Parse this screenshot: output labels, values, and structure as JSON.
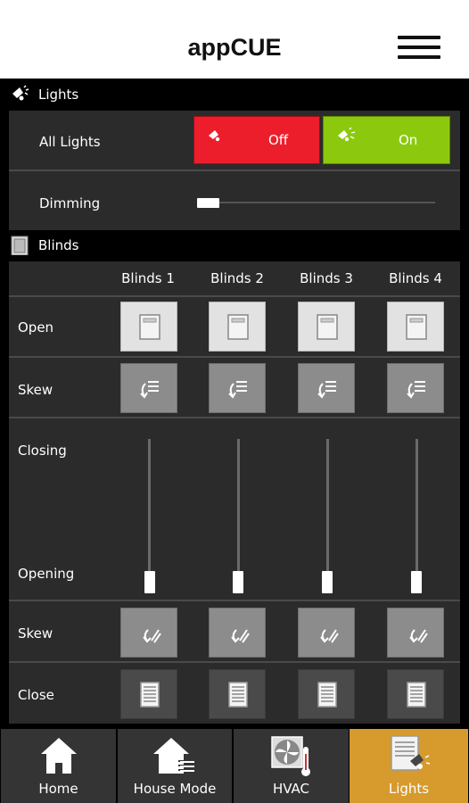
{
  "header": {
    "title": "appCUE",
    "menu_icon": "hamburger-icon"
  },
  "lights": {
    "section_title": "Lights",
    "section_icon": "lamp-icon",
    "all_lights_label": "All Lights",
    "off_label": "Off",
    "on_label": "On",
    "off_color": "#ec1e2c",
    "on_color": "#8cc90e",
    "dimming_label": "Dimming",
    "dimming_level_percent": 5
  },
  "blinds": {
    "section_title": "Blinds",
    "section_icon": "blind-icon",
    "columns": [
      "Blinds 1",
      "Blinds 2",
      "Blinds 3",
      "Blinds 4"
    ],
    "open_label": "Open",
    "skew_label": "Skew",
    "closing_label": "Closing",
    "opening_label": "Opening",
    "skew2_label": "Skew",
    "close_label": "Close",
    "positions_percent_closed": [
      0,
      0,
      0,
      0
    ]
  },
  "nav": {
    "items": [
      {
        "label": "Home",
        "icon": "home-icon"
      },
      {
        "label": "House Mode",
        "icon": "house-mode-icon"
      },
      {
        "label": "HVAC",
        "icon": "hvac-fan-icon"
      },
      {
        "label": "Lights",
        "icon": "lights-icon"
      }
    ],
    "active_color": "#d69a2d"
  }
}
